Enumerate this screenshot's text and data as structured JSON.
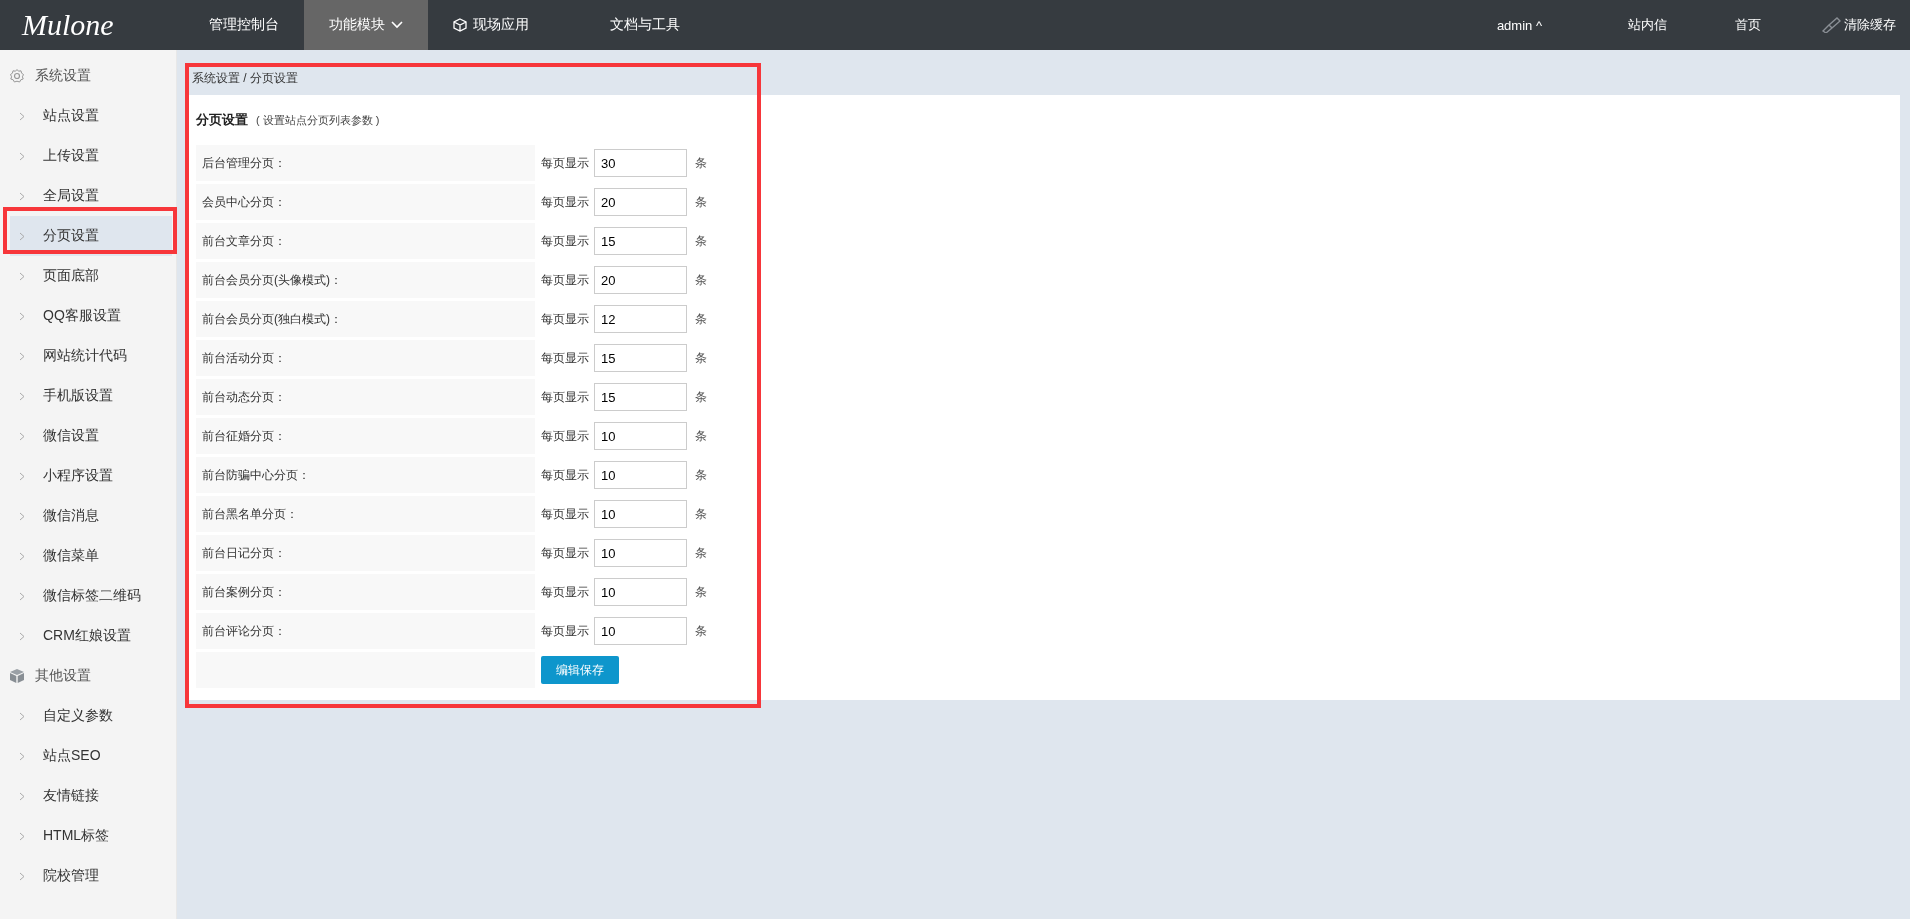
{
  "topbar": {
    "logo": "Mulone",
    "nav": [
      {
        "label": "管理控制台",
        "selected": false,
        "kind": "text"
      },
      {
        "label": "功能模块",
        "selected": true,
        "kind": "dropdown"
      },
      {
        "label": "现场应用",
        "selected": false,
        "kind": "icon"
      },
      {
        "label": "文档与工具",
        "selected": false,
        "kind": "text"
      }
    ],
    "user": "admin ^",
    "links": [
      "站内信",
      "首页"
    ],
    "clear_cache": "清除缓存"
  },
  "sidebar": {
    "groups": [
      {
        "title": "系统设置",
        "kind": "gear",
        "items": [
          {
            "label": "站点设置",
            "selected": false
          },
          {
            "label": "上传设置",
            "selected": false
          },
          {
            "label": "全局设置",
            "selected": false
          },
          {
            "label": "分页设置",
            "selected": true
          },
          {
            "label": "页面底部",
            "selected": false
          },
          {
            "label": "QQ客服设置",
            "selected": false
          },
          {
            "label": "网站统计代码",
            "selected": false
          },
          {
            "label": "手机版设置",
            "selected": false
          },
          {
            "label": "微信设置",
            "selected": false
          },
          {
            "label": "小程序设置",
            "selected": false
          },
          {
            "label": "微信消息",
            "selected": false
          },
          {
            "label": "微信菜单",
            "selected": false
          },
          {
            "label": "微信标签二维码",
            "selected": false
          },
          {
            "label": "CRM红娘设置",
            "selected": false
          }
        ]
      },
      {
        "title": "其他设置",
        "kind": "box",
        "items": [
          {
            "label": "自定义参数",
            "selected": false
          },
          {
            "label": "站点SEO",
            "selected": false
          },
          {
            "label": "友情链接",
            "selected": false
          },
          {
            "label": "HTML标签",
            "selected": false
          },
          {
            "label": "院校管理",
            "selected": false
          }
        ]
      }
    ]
  },
  "breadcrumb": "系统设置 / 分页设置",
  "form": {
    "title": "分页设置",
    "subtitle": "( 设置站点分页列表参数 )",
    "rows": [
      {
        "label": "后台管理分页：",
        "prefix": "每页显示",
        "value": "30",
        "unit": "条"
      },
      {
        "label": "会员中心分页：",
        "prefix": "每页显示",
        "value": "20",
        "unit": "条"
      },
      {
        "label": "前台文章分页：",
        "prefix": "每页显示",
        "value": "15",
        "unit": "条"
      },
      {
        "label": "前台会员分页(头像模式)：",
        "prefix": "每页显示",
        "value": "20",
        "unit": "条"
      },
      {
        "label": "前台会员分页(独白模式)：",
        "prefix": "每页显示",
        "value": "12",
        "unit": "条"
      },
      {
        "label": "前台活动分页：",
        "prefix": "每页显示",
        "value": "15",
        "unit": "条"
      },
      {
        "label": "前台动态分页：",
        "prefix": "每页显示",
        "value": "15",
        "unit": "条"
      },
      {
        "label": "前台征婚分页：",
        "prefix": "每页显示",
        "value": "10",
        "unit": "条"
      },
      {
        "label": "前台防骗中心分页：",
        "prefix": "每页显示",
        "value": "10",
        "unit": "条"
      },
      {
        "label": "前台黑名单分页：",
        "prefix": "每页显示",
        "value": "10",
        "unit": "条"
      },
      {
        "label": "前台日记分页：",
        "prefix": "每页显示",
        "value": "10",
        "unit": "条"
      },
      {
        "label": "前台案例分页：",
        "prefix": "每页显示",
        "value": "10",
        "unit": "条"
      },
      {
        "label": "前台评论分页：",
        "prefix": "每页显示",
        "value": "10",
        "unit": "条"
      }
    ],
    "save": "编辑保存"
  }
}
